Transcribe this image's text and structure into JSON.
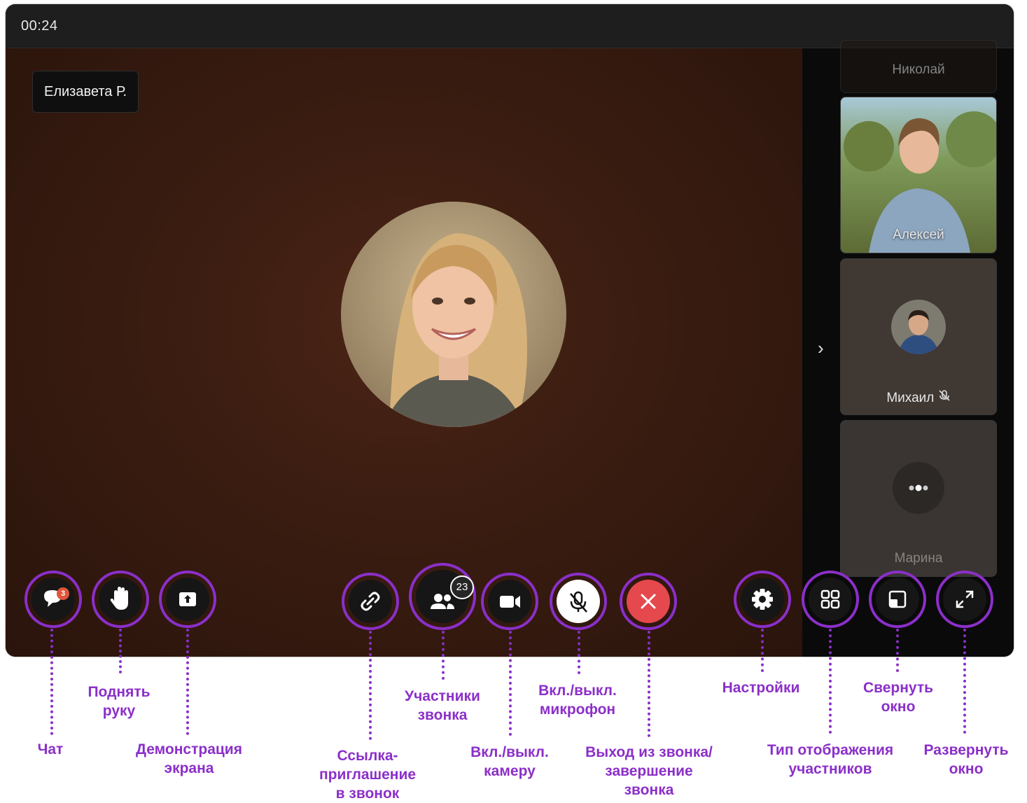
{
  "header": {
    "timer": "00:24"
  },
  "main": {
    "speaker_name": "Елизавета Р."
  },
  "participants": [
    {
      "name": "Николай"
    },
    {
      "name": "Алексей"
    },
    {
      "name": "Михаил"
    },
    {
      "name": "Марина"
    }
  ],
  "controls": {
    "chat_badge": "3",
    "participants_count": "23"
  },
  "annotations": {
    "chat": "Чат",
    "raise_hand": "Поднять\nруку",
    "screen_share": "Демонстрация\nэкрана",
    "invite_link": "Ссылка-\nприглашение\nв звонок",
    "participants": "Участники\nзвонка",
    "camera": "Вкл./выкл.\nкамеру",
    "microphone": "Вкл./выкл.\nмикрофон",
    "leave": "Выход из звонка/\nзавершение\nзвонка",
    "settings": "Настройки",
    "layout": "Тип отображения\nучастников",
    "minimize": "Свернуть\nокно",
    "maximize": "Развернуть\nокно"
  },
  "colors": {
    "accent": "#8b2fc9",
    "end_call": "#e5484d",
    "badge": "#e0553a"
  },
  "icons": [
    "chat-icon",
    "hand-icon",
    "share-screen-icon",
    "link-icon",
    "people-icon",
    "camera-icon",
    "mic-off-icon",
    "close-icon",
    "gear-icon",
    "grid-icon",
    "minimize-icon",
    "expand-icon",
    "chevron-right-icon"
  ]
}
